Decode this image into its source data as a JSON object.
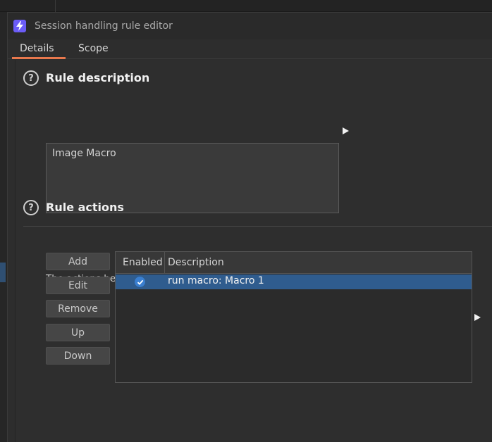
{
  "window": {
    "title": "Session handling rule editor",
    "app_icon": "lightning-bolt-icon",
    "accent_color": "#6b5cf6"
  },
  "tabs": [
    {
      "label": "Details",
      "selected": true
    },
    {
      "label": "Scope",
      "selected": false
    }
  ],
  "tab_accent_color": "#e8784d",
  "rule_description": {
    "heading": "Rule description",
    "value": "Image Macro",
    "help_icon": "question-circle-icon"
  },
  "rule_actions": {
    "heading": "Rule actions",
    "help_icon": "question-circle-icon",
    "info": "The actions below will be performed in sequence when this rule is applied to a request.",
    "buttons": [
      "Add",
      "Edit",
      "Remove",
      "Up",
      "Down"
    ],
    "table": {
      "columns": [
        "Enabled",
        "Description"
      ],
      "rows": [
        {
          "enabled": true,
          "description": "run macro: Macro 1",
          "selected": true
        }
      ]
    },
    "selection_color": "#2f5c8e"
  }
}
